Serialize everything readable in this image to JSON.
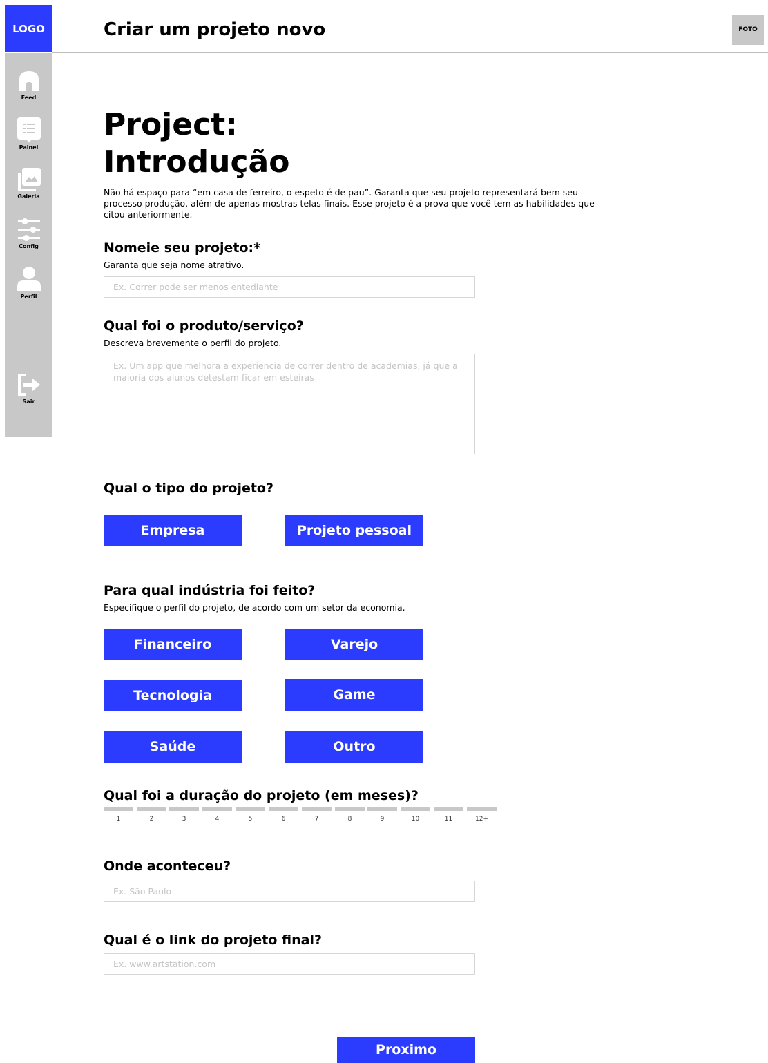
{
  "header": {
    "logo": "LOGO",
    "title": "Criar um projeto novo",
    "avatar": "FOTO"
  },
  "sidebar": {
    "items": [
      {
        "label": "Feed",
        "icon": "home-icon"
      },
      {
        "label": "Painel",
        "icon": "list-icon"
      },
      {
        "label": "Galeria",
        "icon": "gallery-icon"
      },
      {
        "label": "Config",
        "icon": "sliders-icon"
      },
      {
        "label": "Perfil",
        "icon": "user-icon"
      }
    ],
    "logout": {
      "label": "Sair",
      "icon": "logout-icon"
    }
  },
  "page": {
    "title_line1": "Project:",
    "title_line2": "Introdução",
    "intro": "Não há espaço para “em casa de ferreiro, o espeto é de pau”. Garanta que seu projeto representará bem seu processo produção, além de apenas mostras telas finais. Esse projeto é a prova que você tem as habilidades que citou anteriormente."
  },
  "name_section": {
    "title": "Nomeie seu projeto:*",
    "subtitle": "Garanta que seja nome atrativo.",
    "placeholder": "Ex. Correr pode ser menos entediante"
  },
  "product_section": {
    "title": "Qual foi o produto/serviço?",
    "subtitle": "Descreva brevemente o perfil do projeto.",
    "placeholder": "Ex. Um app que melhora a experiencia de correr dentro de academias, já que a maioria dos alunos detestam ficar em esteiras"
  },
  "type_section": {
    "title": "Qual o tipo do projeto?",
    "options": [
      "Empresa",
      "Projeto pessoal"
    ]
  },
  "industry_section": {
    "title": "Para qual indústria foi feito?",
    "subtitle": "Especifique o perfil do projeto, de acordo com um setor da economia.",
    "options": [
      "Financeiro",
      "Varejo",
      "Tecnologia",
      "Game",
      "Saúde",
      "Outro"
    ]
  },
  "duration_section": {
    "title": "Qual foi a duração do projeto (em meses)?",
    "options": [
      "1",
      "2",
      "3",
      "4",
      "5",
      "6",
      "7",
      "8",
      "9",
      "10",
      "11",
      "12+"
    ]
  },
  "location_section": {
    "title": "Onde aconteceu?",
    "placeholder": "Ex. São Paulo"
  },
  "link_section": {
    "title": "Qual é o link do projeto final?",
    "placeholder": "Ex. www.artstation.com"
  },
  "next_button": "Proximo",
  "colors": {
    "accent": "#2b3cff",
    "sidebar": "#c8c8c8",
    "divider": "#bdbdbd"
  }
}
